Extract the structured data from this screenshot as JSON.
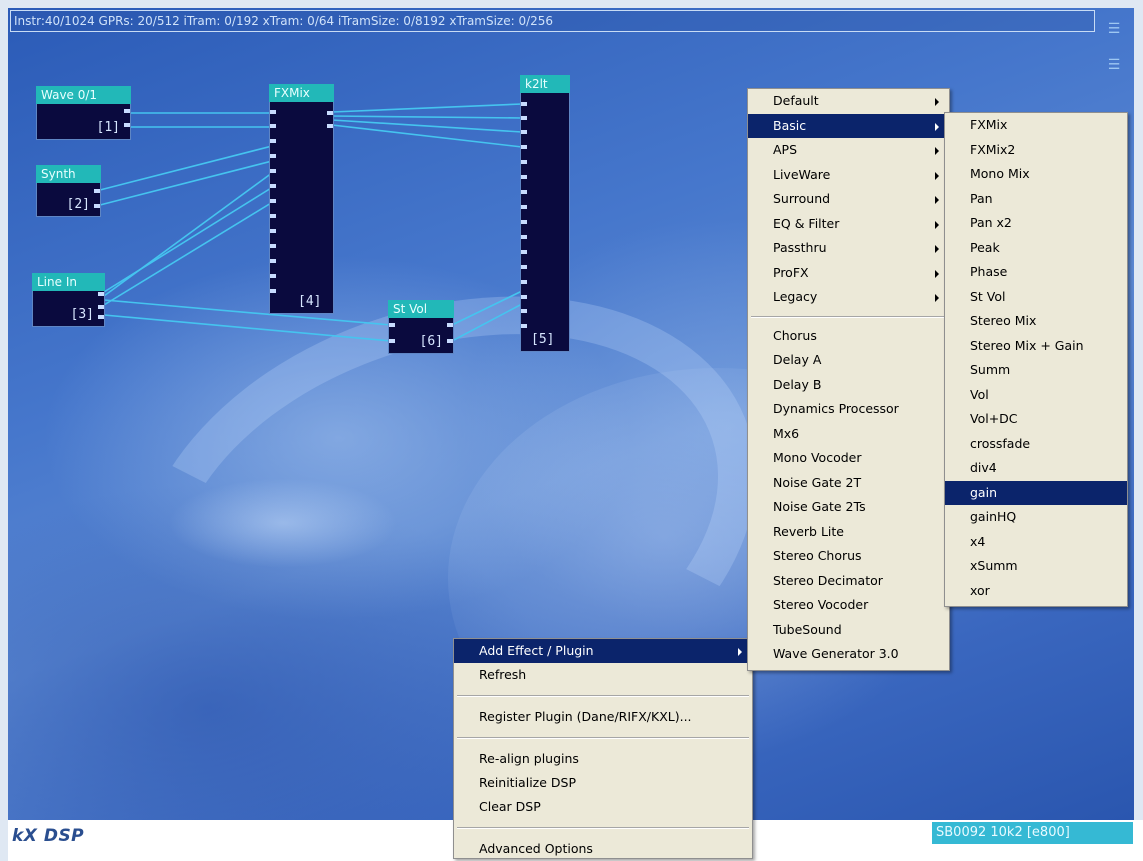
{
  "status_bar": {
    "text": "Instr:40/1024 GPRs: 20/512 iTram: 0/192 xTram: 0/64 iTramSize: 0/8192 xTramSize: 0/256"
  },
  "plugins": [
    {
      "title": "Wave 0/1",
      "index": "[1]"
    },
    {
      "title": "Synth",
      "index": "[2]"
    },
    {
      "title": "Line In",
      "index": "[3]"
    },
    {
      "title": "FXMix",
      "index": "[4]"
    },
    {
      "title": "k2lt",
      "index": "[5]"
    },
    {
      "title": "St Vol",
      "index": "[6]"
    }
  ],
  "bottom_bar": {
    "logo": "kX DSP",
    "device": "SB0092 10k2 [e800]"
  },
  "context_menu": {
    "items": [
      {
        "label": "Add Effect / Plugin",
        "selected": true,
        "submenu": true
      },
      {
        "label": "Refresh"
      },
      {
        "separator": true
      },
      {
        "label": "Register Plugin (Dane/RIFX/KXL)..."
      },
      {
        "separator": true
      },
      {
        "label": "Re-align plugins"
      },
      {
        "label": "Reinitialize DSP"
      },
      {
        "label": "Clear DSP"
      },
      {
        "separator": true
      },
      {
        "label": "Advanced Options"
      }
    ]
  },
  "category_menu": {
    "items": [
      {
        "label": "Default",
        "submenu": true
      },
      {
        "label": "Basic",
        "submenu": true,
        "selected": true
      },
      {
        "label": "APS",
        "submenu": true
      },
      {
        "label": "LiveWare",
        "submenu": true
      },
      {
        "label": "Surround",
        "submenu": true
      },
      {
        "label": "EQ & Filter",
        "submenu": true
      },
      {
        "label": "Passthru",
        "submenu": true
      },
      {
        "label": "ProFX",
        "submenu": true
      },
      {
        "label": "Legacy",
        "submenu": true
      },
      {
        "separator": true
      },
      {
        "label": "Chorus"
      },
      {
        "label": "Delay A"
      },
      {
        "label": "Delay B"
      },
      {
        "label": "Dynamics Processor"
      },
      {
        "label": "Mx6"
      },
      {
        "label": "Mono Vocoder"
      },
      {
        "label": "Noise Gate 2T"
      },
      {
        "label": "Noise Gate 2Ts"
      },
      {
        "label": "Reverb Lite"
      },
      {
        "label": "Stereo Chorus"
      },
      {
        "label": "Stereo Decimator"
      },
      {
        "label": "Stereo Vocoder"
      },
      {
        "label": "TubeSound"
      },
      {
        "label": "Wave Generator 3.0"
      }
    ]
  },
  "basic_menu": {
    "items": [
      {
        "label": "FXMix"
      },
      {
        "label": "FXMix2"
      },
      {
        "label": "Mono Mix"
      },
      {
        "label": "Pan"
      },
      {
        "label": "Pan x2"
      },
      {
        "label": "Peak"
      },
      {
        "label": "Phase"
      },
      {
        "label": "St Vol"
      },
      {
        "label": "Stereo Mix"
      },
      {
        "label": "Stereo Mix + Gain"
      },
      {
        "label": "Summ"
      },
      {
        "label": "Vol"
      },
      {
        "label": "Vol+DC"
      },
      {
        "label": "crossfade"
      },
      {
        "label": "div4"
      },
      {
        "label": "gain",
        "selected": true
      },
      {
        "label": "gainHQ"
      },
      {
        "label": "x4"
      },
      {
        "label": "xSumm"
      },
      {
        "label": "xor"
      }
    ]
  },
  "colors": {
    "plugin_header": "#22b8b8",
    "plugin_body": "#0a0a3e",
    "wire": "#45c4ef",
    "menu_bg": "#ece9d8",
    "menu_selected": "#0b246b"
  }
}
